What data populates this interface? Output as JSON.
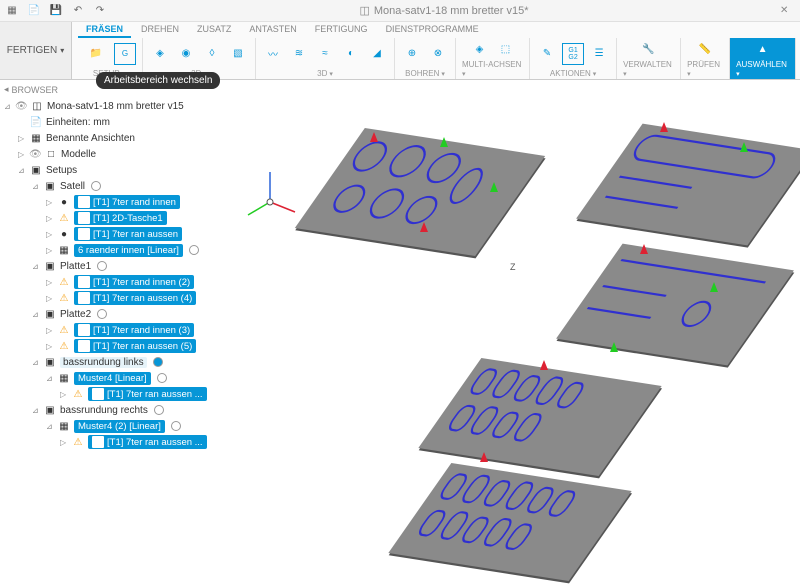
{
  "title": "Mona-satv1-18 mm bretter v15*",
  "workspace": "FERTIGEN",
  "tooltip": "Arbeitsbereich wechseln",
  "tabs": [
    "FRÄSEN",
    "DREHEN",
    "ZUSATZ",
    "ANTASTEN",
    "FERTIGUNG",
    "DIENSTPROGRAMME"
  ],
  "ribbon_groups": [
    {
      "label": "SETUP"
    },
    {
      "label": "2D"
    },
    {
      "label": "3D"
    },
    {
      "label": "BOHREN"
    },
    {
      "label": "MULTI-ACHSEN"
    },
    {
      "label": "AKTIONEN"
    },
    {
      "label": "VERWALTEN"
    },
    {
      "label": "PRÜFEN"
    },
    {
      "label": "AUSWÄHLEN"
    }
  ],
  "browser_label": "BROWSER",
  "tree": {
    "root": "Mona-satv1-18 mm bretter v15",
    "units": "Einheiten: mm",
    "named_views": "Benannte Ansichten",
    "models": "Modelle",
    "setups": "Setups",
    "setup_items": [
      {
        "name": "Satell",
        "ops": [
          {
            "label": "[T1] 7ter rand innen",
            "warn": false
          },
          {
            "label": "[T1] 2D-Tasche1",
            "warn": true
          },
          {
            "label": "[T1] 7ter ran aussen",
            "warn": false
          },
          {
            "label": "6 raender innen [Linear]",
            "warn": false,
            "pattern": true
          }
        ]
      },
      {
        "name": "Platte1",
        "ops": [
          {
            "label": "[T1] 7ter rand innen (2)",
            "warn": true
          },
          {
            "label": "[T1] 7ter ran aussen (4)",
            "warn": true
          }
        ]
      },
      {
        "name": "Platte2",
        "ops": [
          {
            "label": "[T1] 7ter rand innen (3)",
            "warn": true
          },
          {
            "label": "[T1] 7ter ran aussen (5)",
            "warn": true
          }
        ]
      },
      {
        "name": "bassrundung links",
        "ops": [
          {
            "label": "Muster4 [Linear]",
            "pattern": true,
            "children": [
              {
                "label": "[T1] 7ter ran aussen ...",
                "warn": true
              }
            ]
          }
        ],
        "highlighted": true
      },
      {
        "name": "bassrundung rechts",
        "ops": [
          {
            "label": "Muster4 (2) [Linear]",
            "pattern": true,
            "children": [
              {
                "label": "[T1] 7ter ran aussen ...",
                "warn": true
              }
            ]
          }
        ]
      }
    ]
  },
  "axis_label": "Z"
}
